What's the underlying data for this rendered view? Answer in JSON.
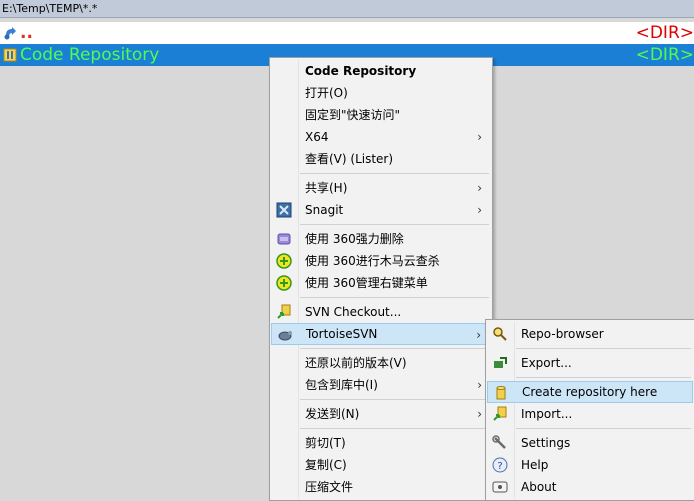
{
  "path": "E:\\Temp\\TEMP\\*.*",
  "rows": {
    "updir": {
      "name": "..",
      "type": "<DIR>"
    },
    "repo": {
      "name": "Code Repository",
      "type": "<DIR>"
    }
  },
  "context_menu": {
    "items": [
      {
        "label": "Code Repository"
      },
      {
        "label": "打开(O)"
      },
      {
        "label": "固定到\"快速访问\""
      },
      {
        "label": "X64"
      },
      {
        "label": "查看(V) (Lister)"
      },
      {
        "label": "共享(H)"
      },
      {
        "label": "Snagit"
      },
      {
        "label": "使用 360强力删除"
      },
      {
        "label": "使用 360进行木马云查杀"
      },
      {
        "label": "使用 360管理右键菜单"
      },
      {
        "label": "SVN Checkout..."
      },
      {
        "label": "TortoiseSVN"
      },
      {
        "label": "还原以前的版本(V)"
      },
      {
        "label": "包含到库中(I)"
      },
      {
        "label": "发送到(N)"
      },
      {
        "label": "剪切(T)"
      },
      {
        "label": "复制(C)"
      },
      {
        "label": "压缩文件"
      }
    ]
  },
  "svn_submenu": {
    "items": [
      {
        "label": "Repo-browser"
      },
      {
        "label": "Export..."
      },
      {
        "label": "Create repository here"
      },
      {
        "label": "Import..."
      },
      {
        "label": "Settings"
      },
      {
        "label": "Help"
      },
      {
        "label": "About"
      }
    ]
  },
  "colors": {
    "selection": "#1b7fd6",
    "dir_text_selected": "#4dff4d",
    "updir_text": "#e0301e",
    "menu_highlight": "#cde6f7"
  }
}
